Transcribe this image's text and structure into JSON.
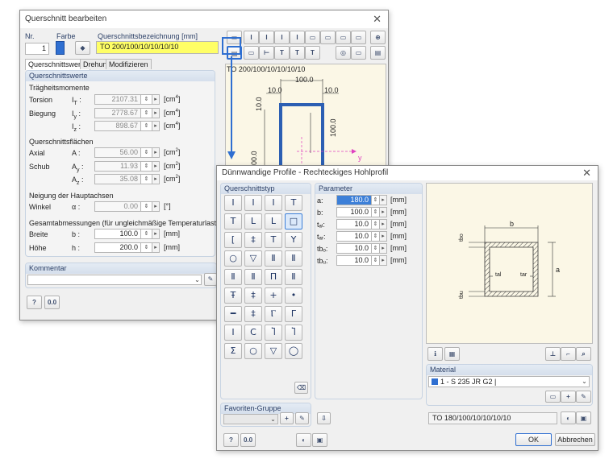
{
  "main_window": {
    "title": "Querschnitt bearbeiten",
    "nr_label": "Nr.",
    "nr_value": "1",
    "farbe_label": "Farbe",
    "bezeichnung_label": "Querschnittsbezeichnung [mm]",
    "bezeichnung_value": "TO 200/100/10/10/10/10",
    "tabs": [
      "Querschnittswerte",
      "Drehung",
      "Modifizieren"
    ],
    "group_title": "Querschnittswerte",
    "traegheit_header": "Trägheitsmomente",
    "rows_traegheit": [
      {
        "label": "Torsion",
        "sym": "I",
        "sub": "T",
        "value": "2107.31",
        "unit": "[cm",
        "exp": "4",
        "end": "]"
      },
      {
        "label": "Biegung",
        "sym": "I",
        "sub": "y",
        "value": "2778.67",
        "unit": "[cm",
        "exp": "4",
        "end": "]"
      },
      {
        "label": "",
        "sym": "I",
        "sub": "z",
        "value": "898.67",
        "unit": "[cm",
        "exp": "4",
        "end": "]"
      }
    ],
    "flaechen_header": "Querschnittsflächen",
    "rows_flaechen": [
      {
        "label": "Axial",
        "sym": "A",
        "sub": "",
        "value": "56.00",
        "unit": "[cm",
        "exp": "2",
        "end": "]"
      },
      {
        "label": "Schub",
        "sym": "A",
        "sub": "y",
        "value": "11.93",
        "unit": "[cm",
        "exp": "2",
        "end": "]"
      },
      {
        "label": "",
        "sym": "A",
        "sub": "z",
        "value": "35.08",
        "unit": "[cm",
        "exp": "2",
        "end": "]"
      }
    ],
    "neigung_header": "Neigung der Hauptachsen",
    "winkel": {
      "label": "Winkel",
      "sym": "α",
      "value": "0.00",
      "unit": "[°]"
    },
    "gesamt_header": "Gesamtabmessungen (für ungleichmäßige Temperaturlasten)",
    "breite": {
      "label": "Breite",
      "sym": "b",
      "value": "100.0",
      "unit": "[mm]"
    },
    "hoehe": {
      "label": "Höhe",
      "sym": "h",
      "value": "200.0",
      "unit": "[mm]"
    },
    "kommentar_label": "Kommentar",
    "preview_title": "TO 200/100/10/10/10/10",
    "preview_dims": {
      "top": "100.0",
      "tl": "10.0",
      "tr": "10.0",
      "left": "10.0",
      "right": "100.0",
      "height": "200.0",
      "axis_y": "y"
    },
    "toolbar_row1": [
      "▭",
      "I",
      "I",
      "I",
      "I",
      "▭",
      "▭",
      "▭",
      "▭",
      "⊕"
    ],
    "toolbar_row2": [
      "▤",
      "▭",
      "⊢",
      "T",
      "T",
      "T",
      "◎",
      "▭",
      "▤"
    ]
  },
  "sub_window": {
    "title": "Dünnwandige Profile - Rechteckiges Hohlprofil",
    "typ_header": "Querschnittstyp",
    "shapes": [
      "I",
      "I",
      "I",
      "T",
      "T",
      "L",
      "L",
      "□",
      "[",
      "‡",
      "T",
      "Y",
      "○",
      "▽",
      "Ⅱ",
      "Ⅱ",
      "Ⅱ",
      "Ⅱ",
      "Π",
      "Ⅱ",
      "Ŧ",
      "‡",
      "+",
      "•",
      "━",
      "‡",
      "Ⲅ",
      "Γ",
      "I",
      "Ⅽ",
      "Ⴈ",
      "Ⴈ",
      "Σ",
      "○",
      "▽",
      "◯"
    ],
    "param_header": "Parameter",
    "params": [
      {
        "label": "a:",
        "value": "180.0",
        "unit": "[mm]",
        "selected": true
      },
      {
        "label": "b:",
        "value": "100.0",
        "unit": "[mm]",
        "selected": false
      },
      {
        "label": "tₐₗ:",
        "value": "10.0",
        "unit": "[mm]",
        "selected": false
      },
      {
        "label": "tₐᵣ:",
        "value": "10.0",
        "unit": "[mm]",
        "selected": false
      },
      {
        "label": "tbₒ:",
        "value": "10.0",
        "unit": "[mm]",
        "selected": false
      },
      {
        "label": "tbᵤ:",
        "value": "10.0",
        "unit": "[mm]",
        "selected": false
      }
    ],
    "favoriten_header": "Favoriten-Gruppe",
    "drawing_labels": {
      "b": "b",
      "a": "a",
      "tbo": "tbo",
      "tbu": "tbu",
      "tal": "tal",
      "tar": "tar"
    },
    "material_header": "Material",
    "material_value": "1 - S 235 JR G2 |",
    "name_value": "TO 180/100/10/10/10/10",
    "ok_label": "OK",
    "cancel_label": "Abbrechen"
  },
  "colors": {
    "accent": "#2f6fd1",
    "highlight": "#ffff66",
    "canvas": "#fbf7e6",
    "profile": "#2c5fb3"
  }
}
